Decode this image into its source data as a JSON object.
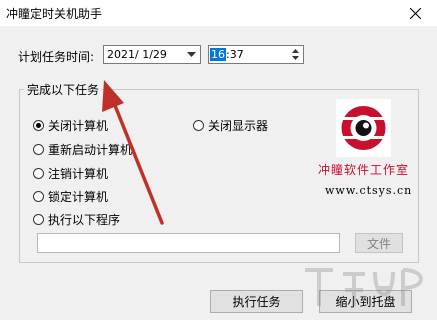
{
  "window": {
    "title": "冲瞳定时关机助手"
  },
  "schedule": {
    "label": "计划任务时间:",
    "date_value": "2021/ 1/29",
    "time_hour": "16",
    "time_rest": ":37"
  },
  "group": {
    "title": "完成以下任务",
    "options": [
      {
        "label": "关闭计算机",
        "checked": true
      },
      {
        "label": "重新启动计算机",
        "checked": false
      },
      {
        "label": "注销计算机",
        "checked": false
      },
      {
        "label": "锁定计算机",
        "checked": false
      },
      {
        "label": "执行以下程序",
        "checked": false
      },
      {
        "label": "关闭显示器",
        "checked": false
      }
    ],
    "file_button": "文件",
    "path_value": ""
  },
  "logo": {
    "name": "冲瞳软件工作室",
    "url": "www.ctsys.cn",
    "brand_color": "#c8102e"
  },
  "buttons": {
    "execute": "执行任务",
    "minimize_tray": "缩小到托盘"
  },
  "annotation": {
    "arrow_color": "#c0302b"
  }
}
